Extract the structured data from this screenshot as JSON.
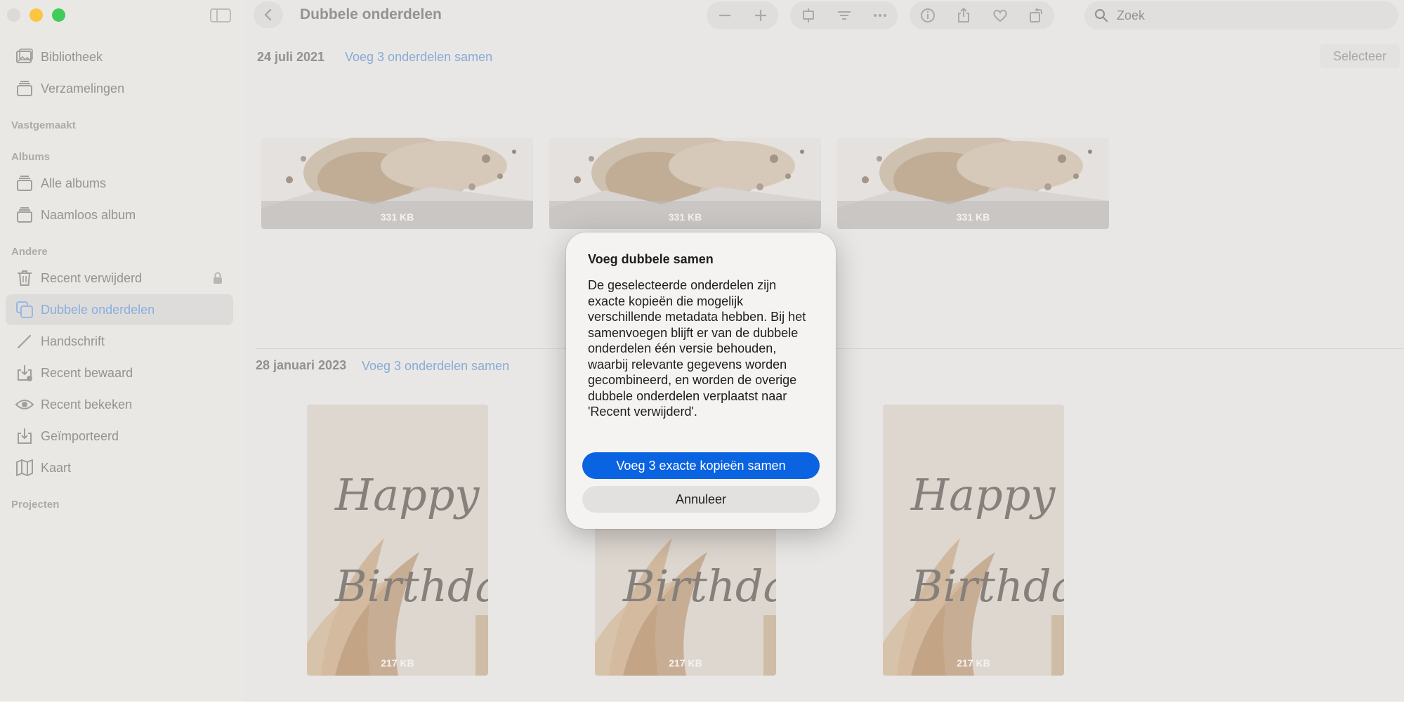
{
  "window": {
    "title": "Dubbele onderdelen"
  },
  "toolbar": {
    "icons": [
      "chevron-left-icon",
      "minus-icon",
      "plus-icon",
      "slideshow-icon",
      "filter-icon",
      "ellipsis-icon",
      "info-icon",
      "share-icon",
      "heart-icon",
      "rotate-icon"
    ],
    "search_placeholder": "Zoek"
  },
  "sidebar": {
    "items_top": [
      {
        "label": "Bibliotheek",
        "icon": "photo-library-icon"
      },
      {
        "label": "Verzamelingen",
        "icon": "stack-icon"
      }
    ],
    "section_pinned": "Vastgemaakt",
    "section_albums": "Albums",
    "albums": [
      {
        "label": "Alle albums",
        "icon": "stack-icon"
      },
      {
        "label": "Naamloos album",
        "icon": "stack-icon"
      }
    ],
    "section_other": "Andere",
    "other": [
      {
        "label": "Recent verwijderd",
        "icon": "trash-icon",
        "locked": true
      },
      {
        "label": "Dubbele onderdelen",
        "icon": "duplicate-icon",
        "active": true
      },
      {
        "label": "Handschrift",
        "icon": "pen-icon"
      },
      {
        "label": "Recent bewaard",
        "icon": "download-icon"
      },
      {
        "label": "Recent bekeken",
        "icon": "eye-icon"
      },
      {
        "label": "Geïmporteerd",
        "icon": "import-icon"
      },
      {
        "label": "Kaart",
        "icon": "map-icon"
      }
    ],
    "section_projects": "Projecten"
  },
  "main": {
    "select_label": "Selecteer",
    "groups": [
      {
        "date": "24 juli 2021",
        "merge_label": "Voeg 3 onderdelen samen",
        "size": "331 KB",
        "sizes": [
          "331 KB",
          "331 KB",
          "331 KB"
        ]
      },
      {
        "date": "28 januari 2023",
        "merge_label": "Voeg 3 onderdelen samen",
        "size": "217 KB",
        "sizes": [
          "217 KB",
          "217 KB",
          "217 KB"
        ]
      }
    ]
  },
  "dialog": {
    "title": "Voeg dubbele samen",
    "message": "De geselecteerde onderdelen zijn exacte kopieën die mogelijk verschillende metadata hebben. Bij het samenvoegen blijft er van de dubbele onderdelen één versie behouden, waarbij relevante gegevens worden gecombineerd, en worden de overige dubbele onderdelen verplaatst naar 'Recent verwijderd'.",
    "primary_label": "Voeg 3 exacte kopieën samen",
    "cancel_label": "Annuleer"
  },
  "colors": {
    "accent": "#0a63e0",
    "link": "#7ea4d3",
    "traffic_min": "#fbc02f",
    "traffic_max": "#2fc84a"
  }
}
